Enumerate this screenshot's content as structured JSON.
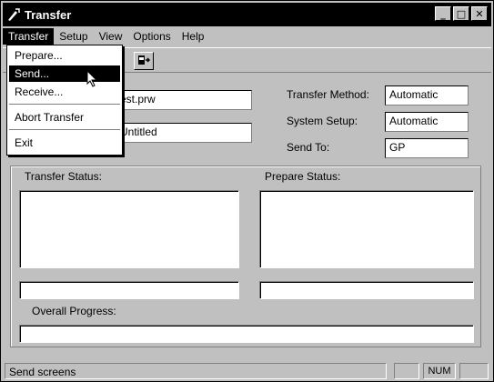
{
  "window": {
    "title": "Transfer"
  },
  "menubar": {
    "items": [
      {
        "label": "Transfer",
        "active": true
      },
      {
        "label": "Setup"
      },
      {
        "label": "View"
      },
      {
        "label": "Options"
      },
      {
        "label": "Help"
      }
    ]
  },
  "dropdown": {
    "items": [
      {
        "label": "Prepare..."
      },
      {
        "label": "Send...",
        "selected": true
      },
      {
        "label": "Receive..."
      },
      {
        "label": "Abort Transfer"
      },
      {
        "label": "Exit"
      }
    ]
  },
  "form": {
    "project_file": "est.prw",
    "screen_title": "Untitled",
    "transfer_method_label": "Transfer Method:",
    "transfer_method_value": "Automatic",
    "system_setup_label": "System Setup:",
    "system_setup_value": "Automatic",
    "send_to_label": "Send To:",
    "send_to_value": "GP"
  },
  "status": {
    "transfer_status_label": "Transfer Status:",
    "prepare_status_label": "Prepare Status:",
    "overall_progress_label": "Overall Progress:"
  },
  "statusbar": {
    "text": "Send screens",
    "num": "NUM"
  }
}
